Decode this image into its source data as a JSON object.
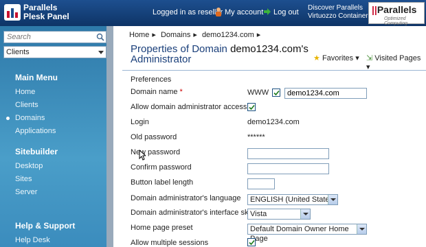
{
  "header": {
    "logo_line1": "Parallels",
    "logo_line2": "Plesk Panel",
    "logged_in": "Logged in as reseller",
    "my_account": "My account",
    "log_out": "Log out",
    "discover_line1": "Discover Parallels",
    "discover_line2": "Virtuozzo Containers",
    "brand_name": "Parallels",
    "brand_tagline": "Optimized Computing"
  },
  "sidebar": {
    "search_placeholder": "Search",
    "select_value": "Clients",
    "main_menu_title": "Main Menu",
    "main_items": [
      "Home",
      "Clients",
      "Domains",
      "Applications"
    ],
    "sitebuilder_title": "Sitebuilder",
    "sitebuilder_items": [
      "Desktop",
      "Sites",
      "Server"
    ],
    "help_title": "Help & Support",
    "help_items": [
      "Help Desk"
    ]
  },
  "breadcrumb": [
    "Home",
    "Domains",
    "demo1234.com"
  ],
  "title": {
    "prefix": "Properties of Domain",
    "domain": "demo1234.com's",
    "suffix": "Administrator"
  },
  "toolbar": {
    "favorites": "Favorites",
    "visited_pages": "Visited Pages"
  },
  "form": {
    "section": "Preferences",
    "domain_name_label": "Domain name",
    "required_mark": "*",
    "www_label": "WWW",
    "www_checked": true,
    "domain_name_value": "demo1234.com",
    "allow_access_label": "Allow domain administrator access",
    "allow_access_checked": true,
    "login_label": "Login",
    "login_value": "demo1234.com",
    "old_password_label": "Old password",
    "old_password_value": "******",
    "new_password_label": "New password",
    "confirm_password_label": "Confirm password",
    "button_label_length_label": "Button label length",
    "language_label": "Domain administrator's language",
    "language_value": "ENGLISH (United States)",
    "skin_label": "Domain administrator's interface skin",
    "skin_value": "Vista",
    "home_page_preset_label": "Home page preset",
    "home_page_preset_value": "Default Domain Owner Home Page",
    "allow_multiple_sessions_label": "Allow multiple sessions",
    "allow_multiple_sessions_checked": true
  },
  "colors": {
    "header_bg": "#0e3466",
    "sidebar_bg": "#3b8cbd",
    "title_color": "#1a3f7a",
    "required_color": "#cc0000"
  }
}
